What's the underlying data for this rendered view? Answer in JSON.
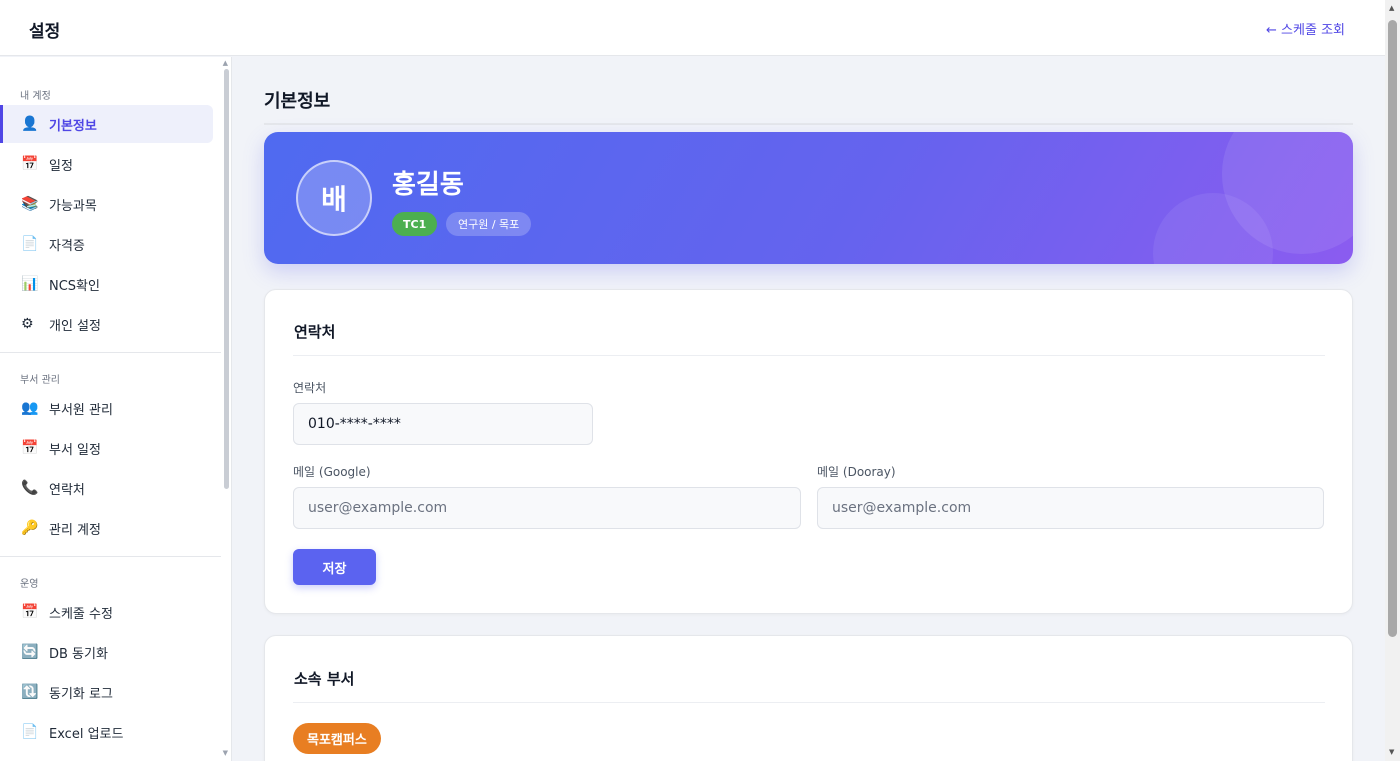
{
  "header": {
    "title": "설정",
    "back_link": "← 스케줄 조회"
  },
  "sidebar": {
    "sections": [
      {
        "label": "내 계정"
      },
      {
        "label": "부서 관리"
      },
      {
        "label": "운영"
      }
    ],
    "items": [
      {
        "icon": "👤",
        "icon_name": "user-icon",
        "label": "기본정보",
        "active": true
      },
      {
        "icon": "📅",
        "icon_name": "calendar-icon",
        "label": "일정"
      },
      {
        "icon": "📚",
        "icon_name": "books-icon",
        "label": "가능과목"
      },
      {
        "icon": "📄",
        "icon_name": "document-icon",
        "label": "자격증"
      },
      {
        "icon": "📊",
        "icon_name": "bar-chart-icon",
        "label": "NCS확인"
      },
      {
        "icon": "⚙",
        "icon_name": "gear-icon",
        "label": "개인 설정"
      },
      {
        "icon": "👥",
        "icon_name": "users-icon",
        "label": "부서원 관리"
      },
      {
        "icon": "📅",
        "icon_name": "calendar-icon",
        "label": "부서 일정"
      },
      {
        "icon": "📞",
        "icon_name": "phone-icon",
        "label": "연락처"
      },
      {
        "icon": "🔑",
        "icon_name": "key-icon",
        "label": "관리 계정"
      },
      {
        "icon": "📅",
        "icon_name": "calendar-icon",
        "label": "스케줄 수정"
      },
      {
        "icon": "🔄",
        "icon_name": "sync-icon",
        "label": "DB 동기화"
      },
      {
        "icon": "🔃",
        "icon_name": "reload-icon",
        "label": "동기화 로그"
      },
      {
        "icon": "📄",
        "icon_name": "document-icon",
        "label": "Excel 업로드"
      }
    ]
  },
  "main": {
    "page_title": "기본정보",
    "profile": {
      "avatar_text": "배",
      "name": "홍길동",
      "badge": "TC1",
      "role": "연구원 / 목포"
    },
    "contact": {
      "title": "연락처",
      "phone_label": "연락처",
      "phone_value": "010-****-****",
      "google_label": "메일 (Google)",
      "google_placeholder": "user@example.com",
      "dooray_label": "메일 (Dooray)",
      "dooray_placeholder": "user@example.com",
      "save_label": "저장"
    },
    "department": {
      "title": "소속 부서",
      "badge": "목포캠퍼스"
    }
  },
  "colors": {
    "accent": "#4f46e5",
    "hero_start": "#4f6af0",
    "hero_end": "#8b5cf0",
    "badge_green": "#4caf50",
    "dept_orange": "#e87e22"
  }
}
